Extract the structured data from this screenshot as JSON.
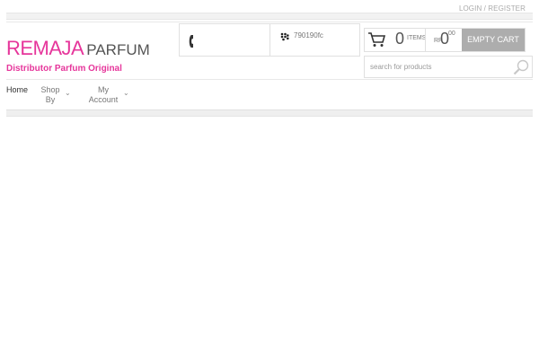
{
  "topbar": {
    "account_link": "Login / Register"
  },
  "logo": {
    "brand": "REMAJA",
    "sub": "PARFUM",
    "tagline": "Distributor Parfum Original"
  },
  "contact": {
    "bb_pin": "790190fc"
  },
  "cart": {
    "count": "0",
    "items_label": "ITEMS",
    "currency": "RP",
    "price": "0",
    "price_decimals": "00",
    "empty_label": "EMPTY CART"
  },
  "search": {
    "placeholder": "search for products"
  },
  "nav": {
    "items": [
      {
        "line1": "Home",
        "line2": ""
      },
      {
        "line1": "Shop",
        "line2": "By"
      },
      {
        "line1": "My",
        "line2": "Account"
      }
    ]
  },
  "colors": {
    "brand_pink": "#e6369b",
    "button_gray": "#adadad"
  },
  "icons": [
    "phone-icon",
    "blackberry-icon",
    "cart-icon",
    "search-icon",
    "chevron-down-icon"
  ]
}
